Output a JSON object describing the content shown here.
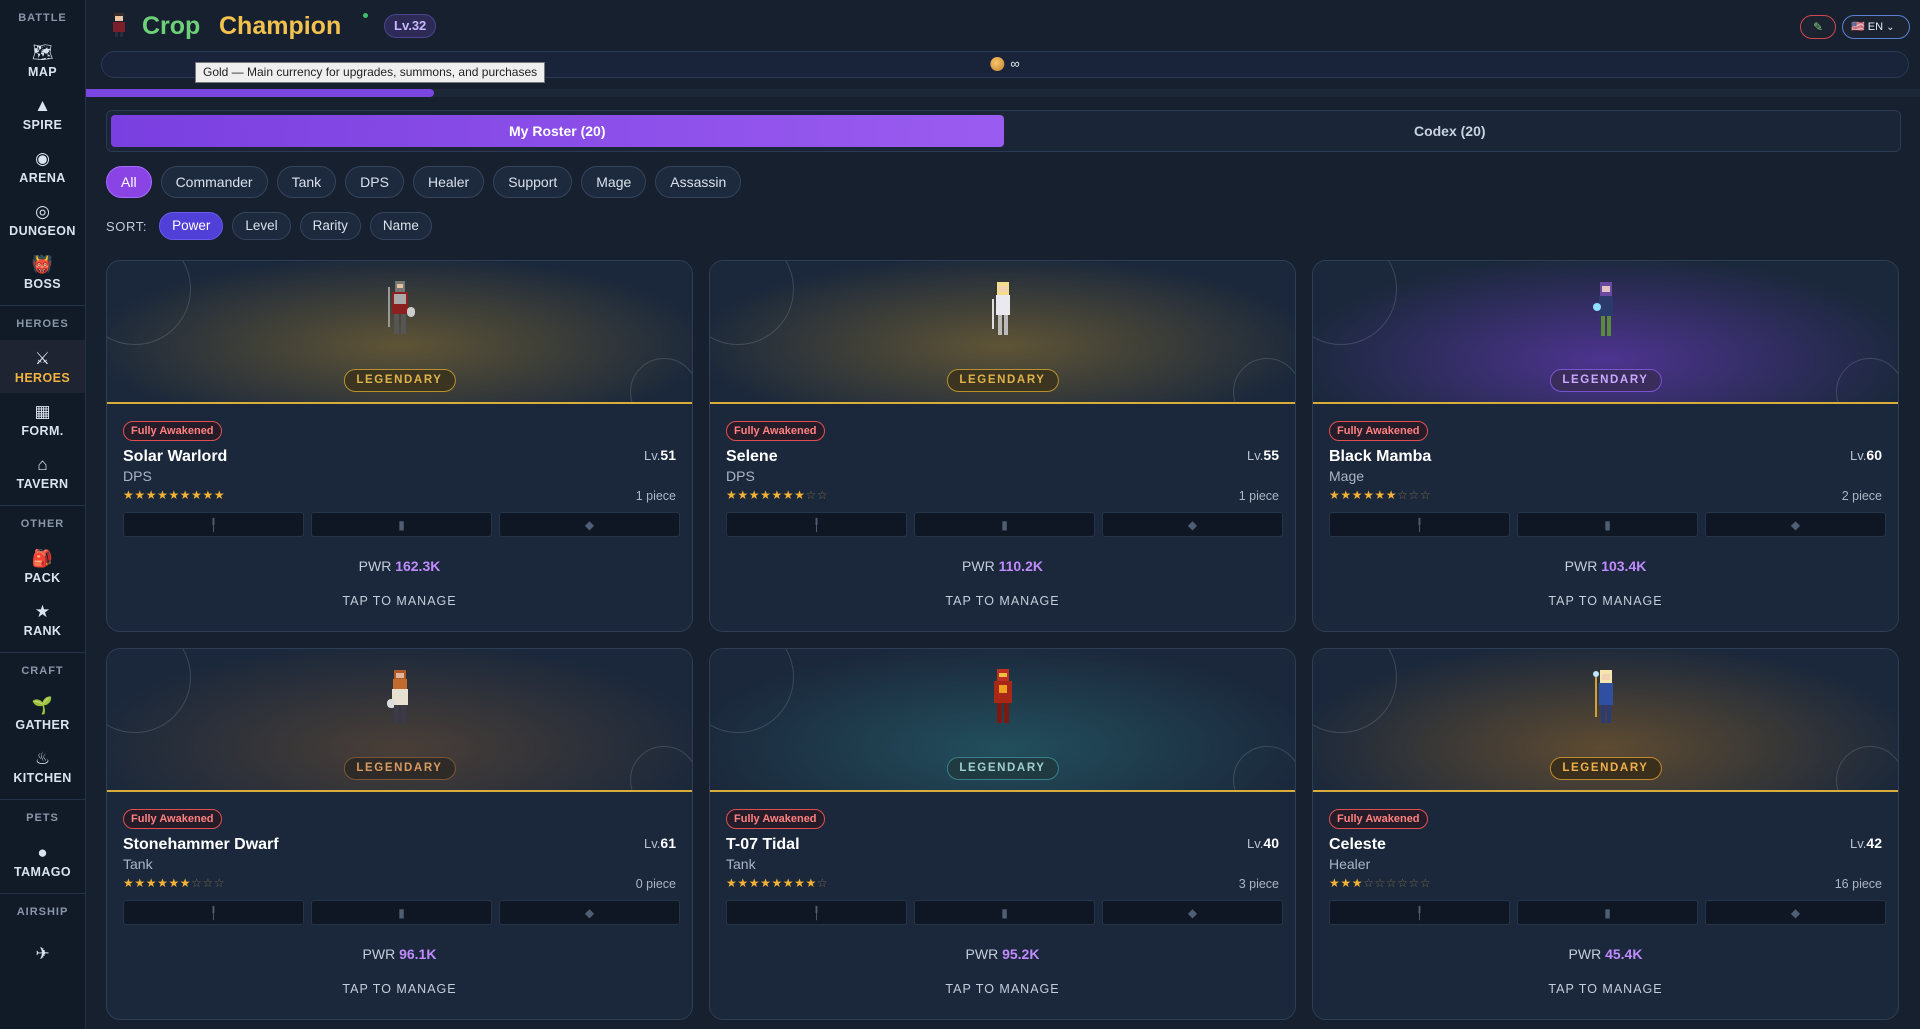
{
  "header": {
    "title_part1": "Crop",
    "title_part2": "Champion",
    "level": "Lv.32",
    "lang": "🇺🇸 EN",
    "edit_icon": "pencil-icon"
  },
  "currency": {
    "value": "∞",
    "tooltip": "Gold — Main currency for upgrades, summons, and purchases"
  },
  "xp_progress": 0.19,
  "sidebar": {
    "sections": [
      {
        "title": "BATTLE",
        "items": [
          {
            "label": "MAP",
            "icon": "🗺"
          },
          {
            "label": "SPIRE",
            "icon": "▲"
          },
          {
            "label": "ARENA",
            "icon": "◉"
          },
          {
            "label": "DUNGEON",
            "icon": "◎"
          },
          {
            "label": "BOSS",
            "icon": "👹"
          }
        ]
      },
      {
        "title": "HEROES",
        "items": [
          {
            "label": "HEROES",
            "icon": "⚔",
            "active": true
          },
          {
            "label": "FORM.",
            "icon": "▦"
          },
          {
            "label": "TAVERN",
            "icon": "⌂"
          }
        ]
      },
      {
        "title": "OTHER",
        "items": [
          {
            "label": "PACK",
            "icon": "🎒"
          },
          {
            "label": "RANK",
            "icon": "★"
          }
        ]
      },
      {
        "title": "CRAFT",
        "items": [
          {
            "label": "GATHER",
            "icon": "🌱"
          },
          {
            "label": "KITCHEN",
            "icon": "♨"
          }
        ]
      },
      {
        "title": "PETS",
        "items": [
          {
            "label": "TAMAGO",
            "icon": "●"
          }
        ]
      },
      {
        "title": "AIRSHIP",
        "items": [
          {
            "label": "",
            "icon": "✈"
          }
        ]
      }
    ]
  },
  "tabs": [
    {
      "label": "My Roster (20)",
      "active": true
    },
    {
      "label": "Codex (20)",
      "active": false
    }
  ],
  "filters": [
    "All",
    "Commander",
    "Tank",
    "DPS",
    "Healer",
    "Support",
    "Mage",
    "Assassin"
  ],
  "active_filter": "All",
  "sort": {
    "label": "SORT:",
    "options": [
      "Power",
      "Level",
      "Rarity",
      "Name"
    ],
    "active": "Power"
  },
  "card_labels": {
    "awakened": "Fully Awakened",
    "lv_prefix": "Lv.",
    "pwr_prefix": "PWR",
    "manage": "TAP TO MANAGE"
  },
  "heroes": [
    {
      "name": "Solar Warlord",
      "class": "DPS",
      "level": "51",
      "rarity": "LEGENDARY",
      "stars": 9,
      "max_stars": 9,
      "pieces": "1 piece",
      "power": "162.3K",
      "theme": "gold"
    },
    {
      "name": "Selene",
      "class": "DPS",
      "level": "55",
      "rarity": "LEGENDARY",
      "stars": 7,
      "max_stars": 9,
      "pieces": "1 piece",
      "power": "110.2K",
      "theme": "gold"
    },
    {
      "name": "Black Mamba",
      "class": "Mage",
      "level": "60",
      "rarity": "LEGENDARY",
      "stars": 6,
      "max_stars": 9,
      "pieces": "2 piece",
      "power": "103.4K",
      "theme": "purple"
    },
    {
      "name": "Stonehammer Dwarf",
      "class": "Tank",
      "level": "61",
      "rarity": "LEGENDARY",
      "stars": 6,
      "max_stars": 9,
      "pieces": "0 piece",
      "power": "96.1K",
      "theme": "bronze"
    },
    {
      "name": "T-07 Tidal",
      "class": "Tank",
      "level": "40",
      "rarity": "LEGENDARY",
      "stars": 8,
      "max_stars": 9,
      "pieces": "3 piece",
      "power": "95.2K",
      "theme": "teal"
    },
    {
      "name": "Celeste",
      "class": "Healer",
      "level": "42",
      "rarity": "LEGENDARY",
      "stars": 3,
      "max_stars": 9,
      "pieces": "16 piece",
      "power": "45.4K",
      "theme": "amber"
    }
  ],
  "colors": {
    "accent_purple": "#8a44e6",
    "legendary_gold": "#d8ad3a",
    "power_value": "#c08bff",
    "star": "#f5b336"
  }
}
